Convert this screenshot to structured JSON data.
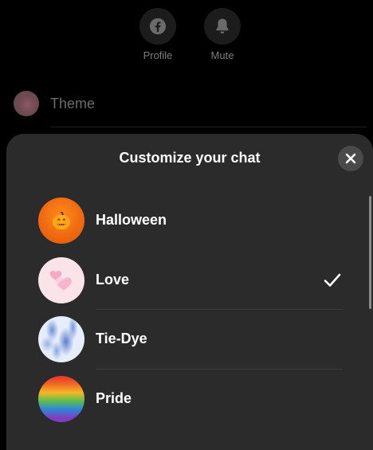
{
  "top_actions": [
    {
      "label": "Profile",
      "icon": "facebook-icon"
    },
    {
      "label": "Mute",
      "icon": "bell-icon"
    }
  ],
  "theme_row": {
    "label": "Theme"
  },
  "sheet": {
    "title": "Customize your chat",
    "close_icon": "close-icon",
    "themes": [
      {
        "name": "Halloween",
        "selected": false
      },
      {
        "name": "Love",
        "selected": true
      },
      {
        "name": "Tie-Dye",
        "selected": false
      },
      {
        "name": "Pride",
        "selected": false
      }
    ]
  },
  "colors": {
    "background": "#000000",
    "sheet": "#2b2b2b",
    "close_button": "#4a4a4a",
    "muted_text": "#7c7c7c",
    "primary_text": "#ffffff"
  }
}
